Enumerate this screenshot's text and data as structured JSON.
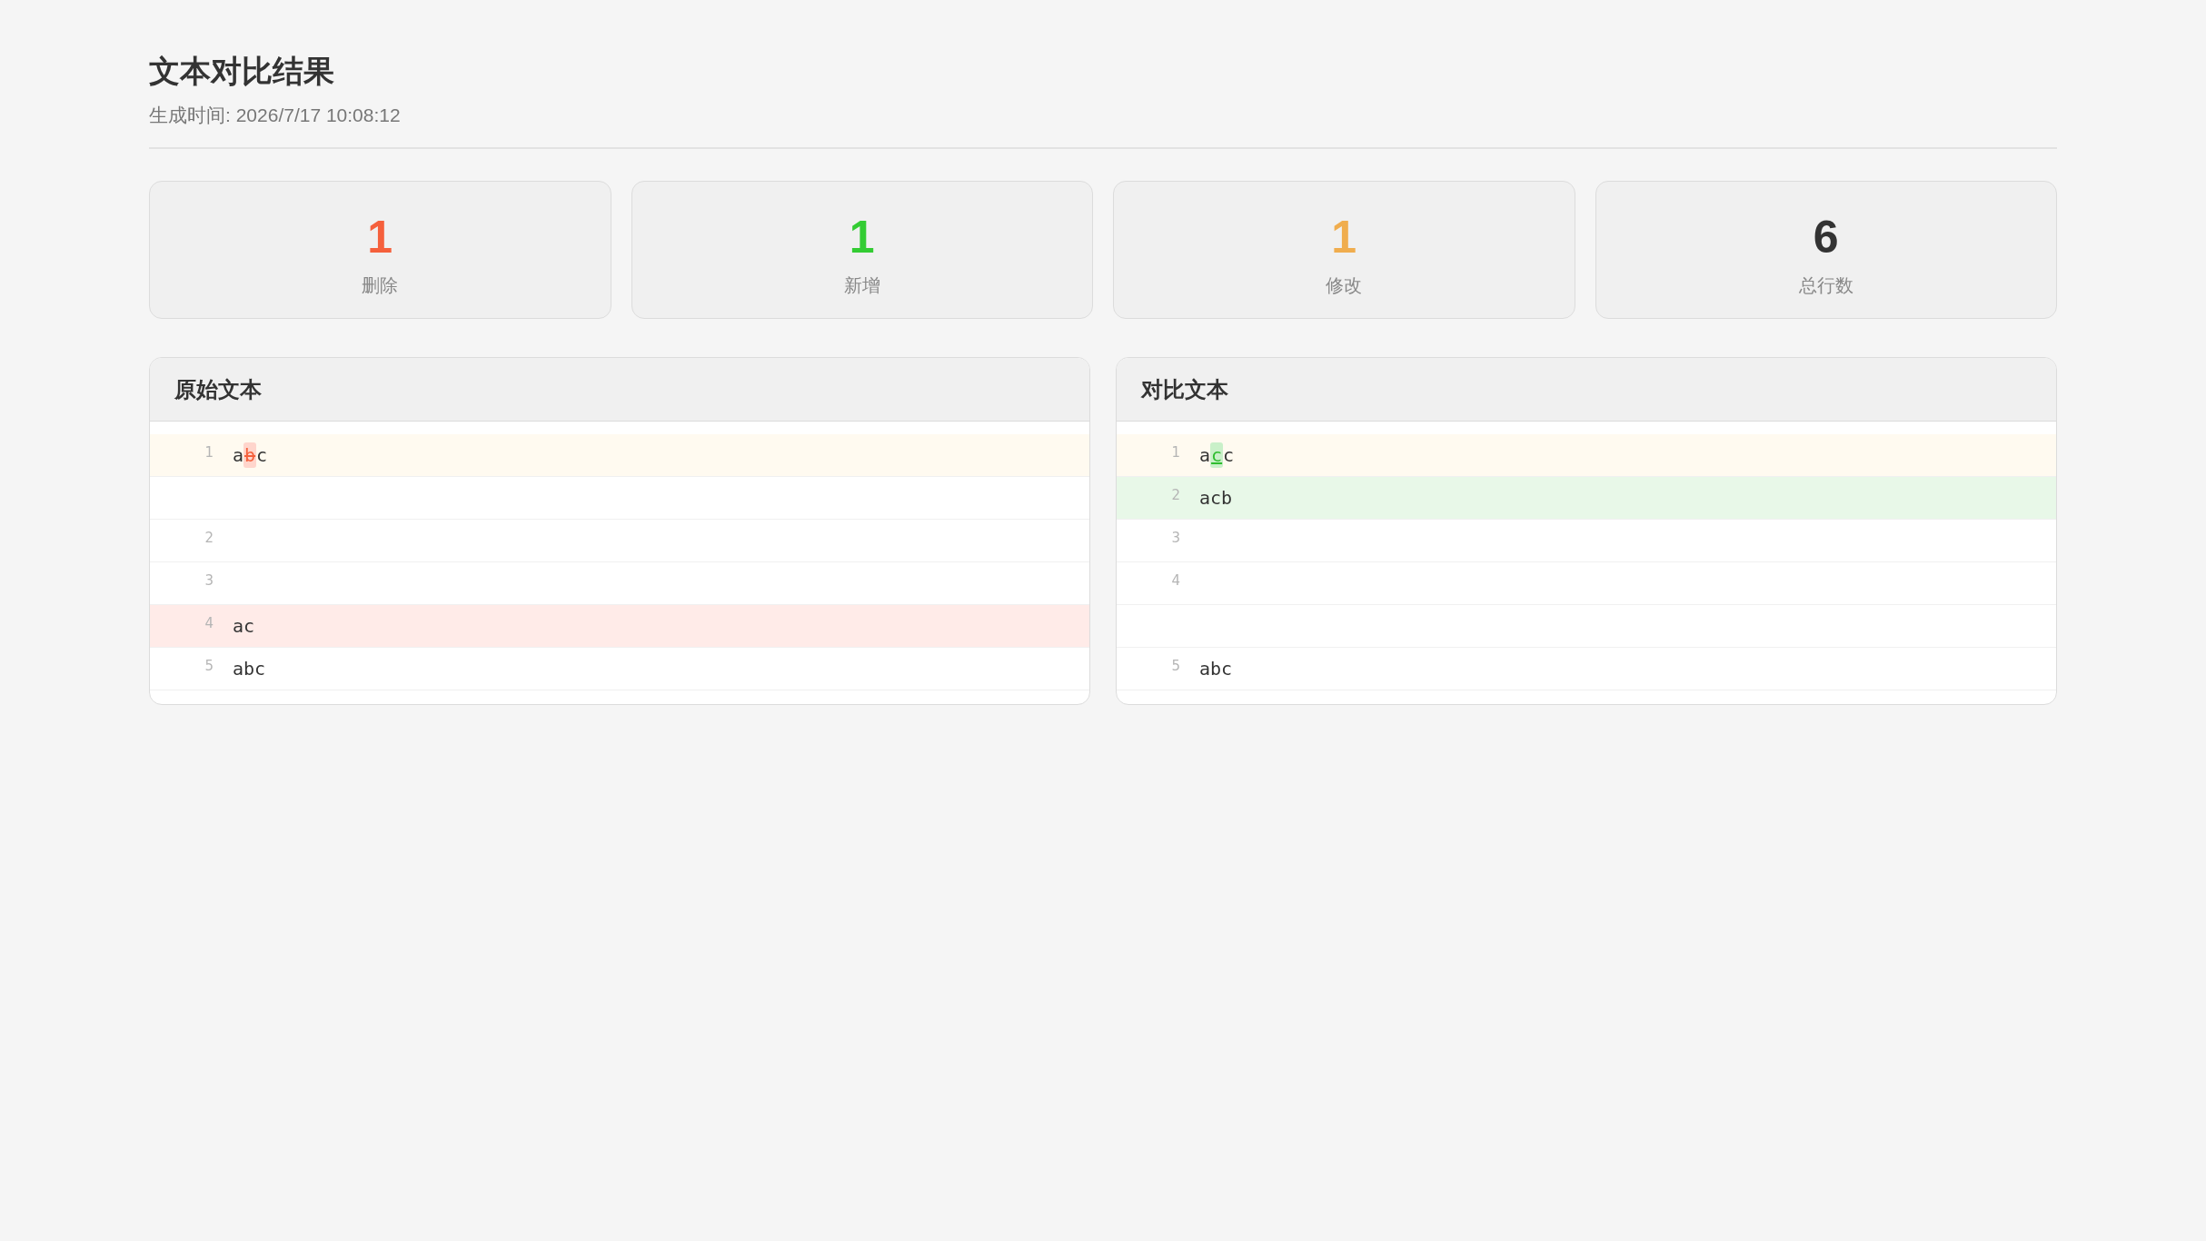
{
  "header": {
    "title": "文本对比结果",
    "generated": "生成时间: 2026/7/17 10:08:12"
  },
  "stats": [
    {
      "value": "1",
      "label": "删除",
      "color": "#f5603c"
    },
    {
      "value": "1",
      "label": "新增",
      "color": "#33cc33"
    },
    {
      "value": "1",
      "label": "修改",
      "color": "#f0ad4e"
    },
    {
      "value": "6",
      "label": "总行数",
      "color": "#333333"
    }
  ],
  "panels": [
    {
      "title": "原始文本",
      "lines": [
        {
          "kind": "modified",
          "number": "1",
          "segments": [
            {
              "kind": "same",
              "text": "a"
            },
            {
              "kind": "removed",
              "text": "b"
            },
            {
              "kind": "same",
              "text": "c"
            }
          ]
        },
        {
          "kind": "blank"
        },
        {
          "kind": "same",
          "number": "2"
        },
        {
          "kind": "same",
          "number": "3"
        },
        {
          "kind": "removed",
          "number": "4",
          "segments": [
            {
              "kind": "same",
              "text": "ac"
            }
          ]
        },
        {
          "kind": "same",
          "number": "5",
          "segments": [
            {
              "kind": "same",
              "text": "abc"
            }
          ]
        }
      ]
    },
    {
      "title": "对比文本",
      "lines": [
        {
          "kind": "modified",
          "number": "1",
          "segments": [
            {
              "kind": "same",
              "text": "a"
            },
            {
              "kind": "added",
              "text": "c"
            },
            {
              "kind": "same",
              "text": "c"
            }
          ]
        },
        {
          "kind": "added",
          "number": "2",
          "segments": [
            {
              "kind": "same",
              "text": "acb"
            }
          ]
        },
        {
          "kind": "same",
          "number": "3"
        },
        {
          "kind": "same",
          "number": "4"
        },
        {
          "kind": "blank"
        },
        {
          "kind": "same",
          "number": "5",
          "segments": [
            {
              "kind": "same",
              "text": "abc"
            }
          ]
        }
      ]
    }
  ]
}
